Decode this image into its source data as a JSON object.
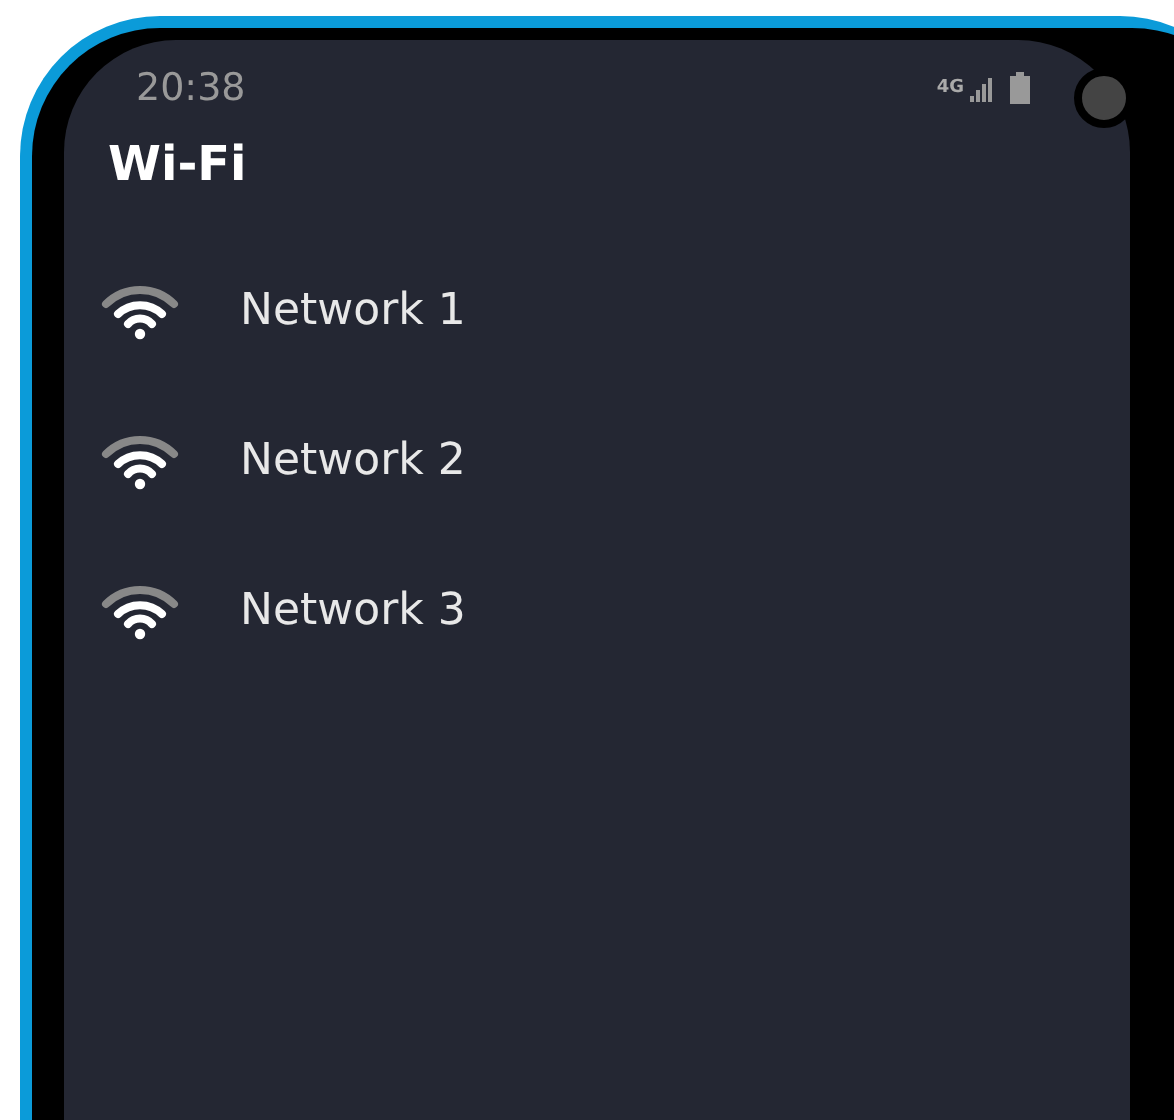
{
  "status_bar": {
    "time": "20:38",
    "network": "4G"
  },
  "title": "Wi-Fi",
  "networks": [
    {
      "name": "Network 1"
    },
    {
      "name": "Network 2"
    },
    {
      "name": "Network 3"
    }
  ]
}
